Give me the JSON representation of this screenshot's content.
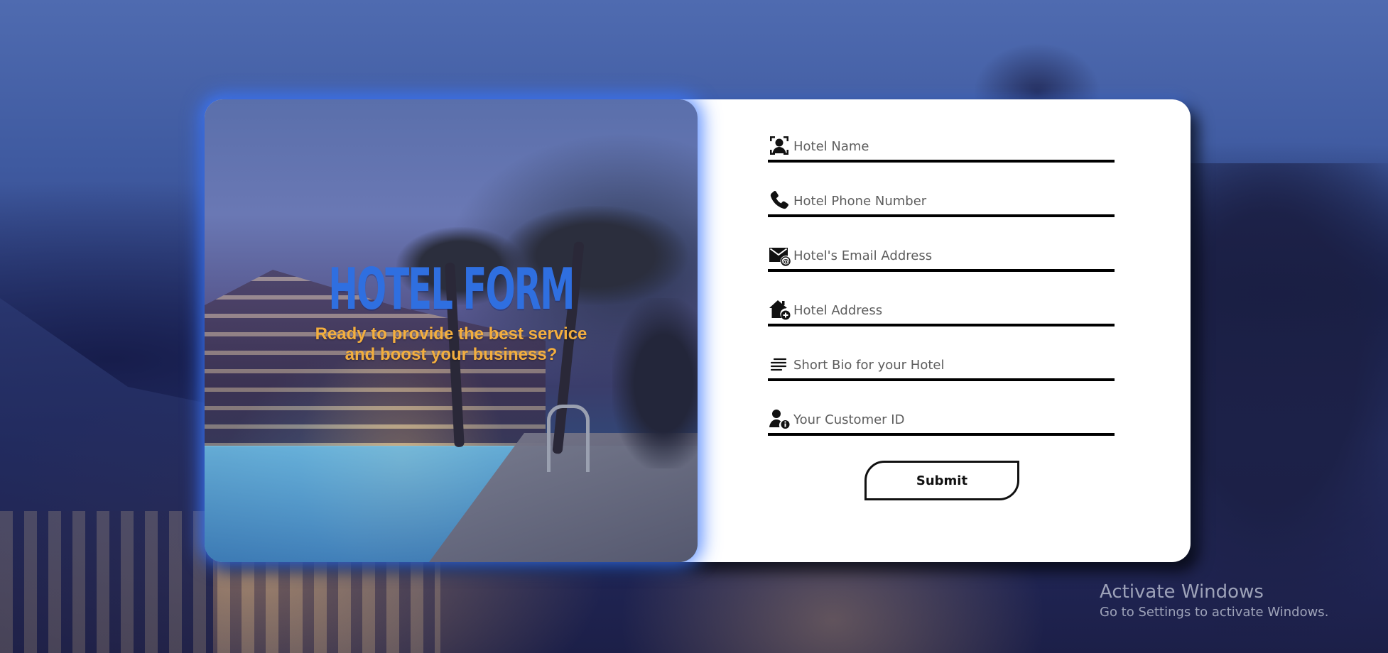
{
  "hero": {
    "title": "HOTEL FORM",
    "subtitle_line1": "Ready to provide the best service",
    "subtitle_line2": "and boost your business?"
  },
  "form": {
    "fields": [
      {
        "icon": "user-badge-icon",
        "placeholder": "Hotel Name",
        "value": ""
      },
      {
        "icon": "phone-icon",
        "placeholder": "Hotel Phone Number",
        "value": ""
      },
      {
        "icon": "email-at-icon",
        "placeholder": "Hotel's Email Address",
        "value": ""
      },
      {
        "icon": "house-add-icon",
        "placeholder": "Hotel Address",
        "value": ""
      },
      {
        "icon": "text-lines-icon",
        "placeholder": "Short Bio for your Hotel",
        "value": ""
      },
      {
        "icon": "user-info-icon",
        "placeholder": "Your Customer ID",
        "value": ""
      }
    ],
    "submit_label": "Submit"
  },
  "watermark": {
    "line1": "Activate Windows",
    "line2": "Go to Settings to activate Windows."
  },
  "colors": {
    "accent_blue": "#2f6fe0",
    "subtitle_orange": "#f3ae3f",
    "card_bg": "#ffffff",
    "line_black": "#000000"
  }
}
